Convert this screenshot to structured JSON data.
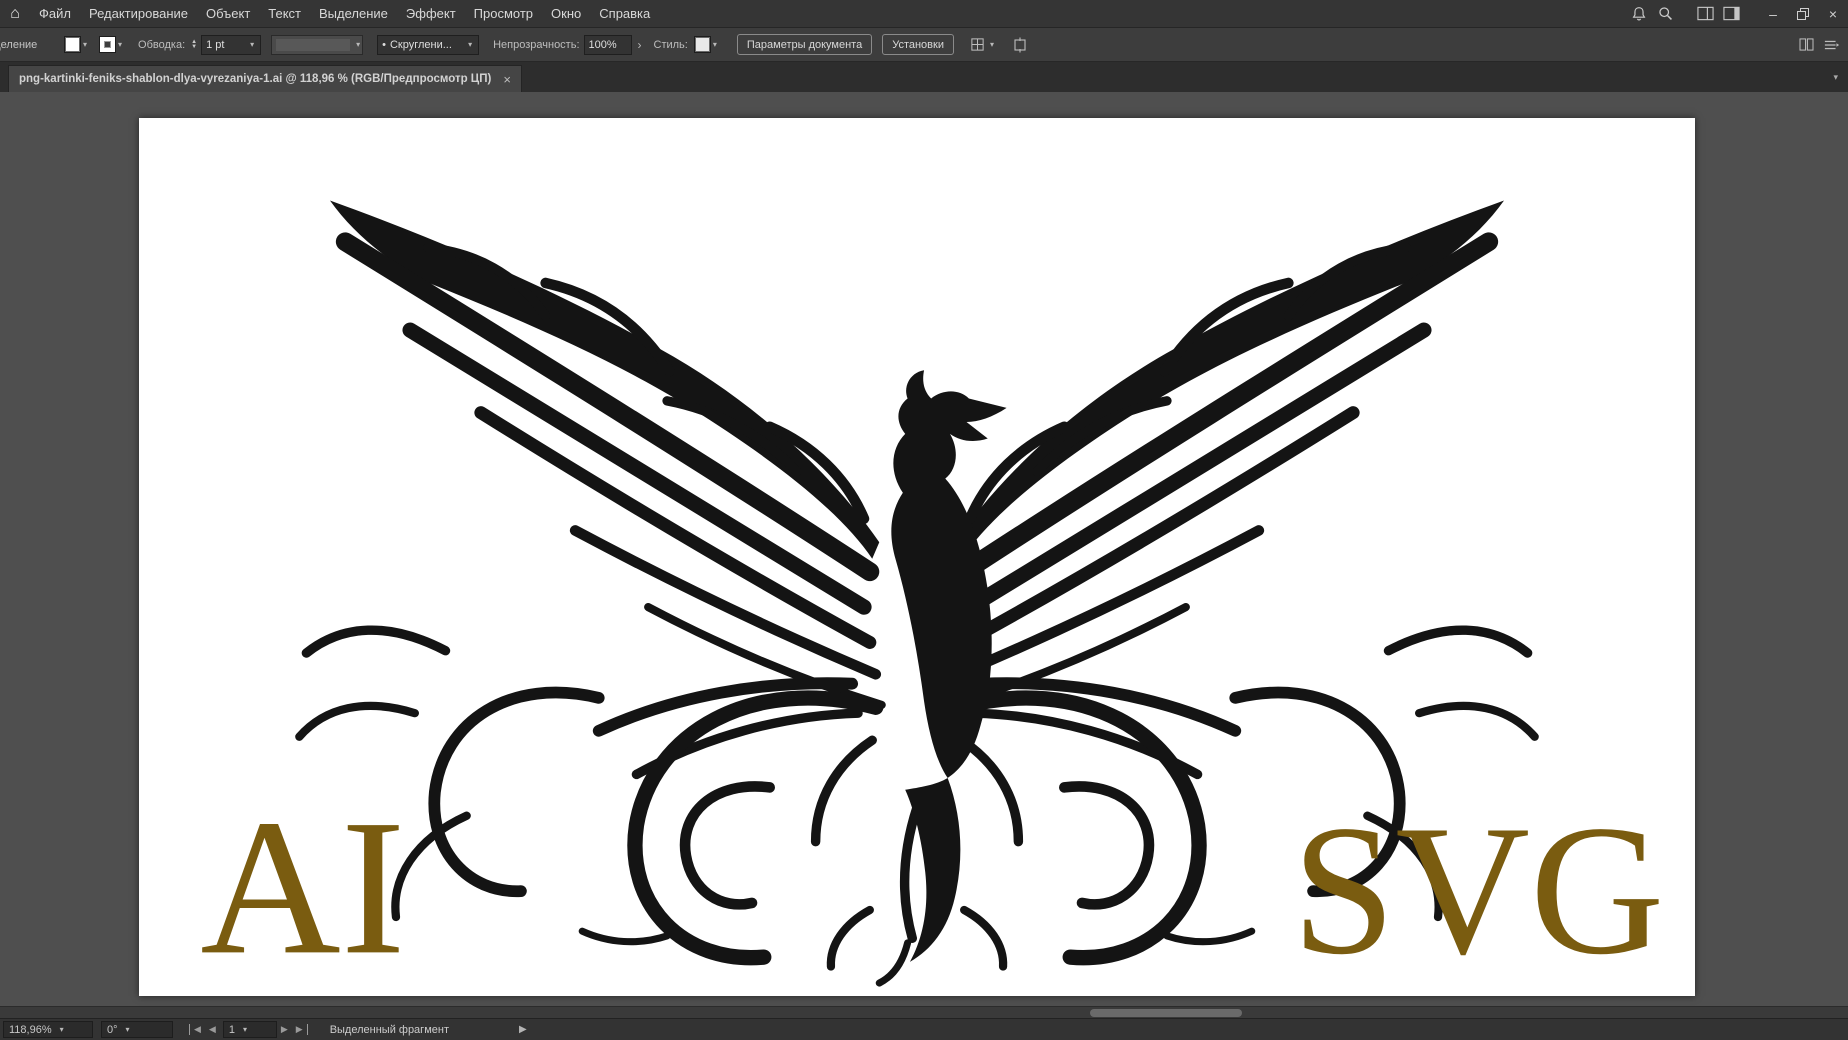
{
  "menu_bar": {
    "items": [
      "Файл",
      "Редактирование",
      "Объект",
      "Текст",
      "Выделение",
      "Эффект",
      "Просмотр",
      "Окно",
      "Справка"
    ]
  },
  "control_bar": {
    "tool_label": "Выделение",
    "stroke_label": "Обводка:",
    "stroke_value": "1 pt",
    "brush_value": "Скруглени...",
    "opacity_label": "Непрозрачность:",
    "opacity_value": "100%",
    "style_label": "Стиль:",
    "document_setup": "Параметры документа",
    "preferences": "Установки"
  },
  "document_tab": {
    "title": "png-kartinki-feniks-shablon-dlya-vyrezaniya-1.ai @ 118,96 % (RGB/Предпросмотр ЦП)"
  },
  "artboard": {
    "left_text": "AI",
    "right_text": "SVG",
    "text_color": "#7a5c10",
    "artwork_color": "#141414"
  },
  "status_bar": {
    "zoom": "118,96%",
    "rotation": "0°",
    "artboard_number": "1",
    "status_label": "Выделенный фрагмент"
  },
  "icons": {
    "home": "⌂",
    "chevron": "▾",
    "submenu_arrow": "›",
    "stepper_up": "▲",
    "stepper_down": "▼",
    "brush_dot": "•",
    "nav_prev": "◀",
    "nav_next": "▶",
    "play": "▶",
    "close": "×",
    "minimize": "–"
  }
}
